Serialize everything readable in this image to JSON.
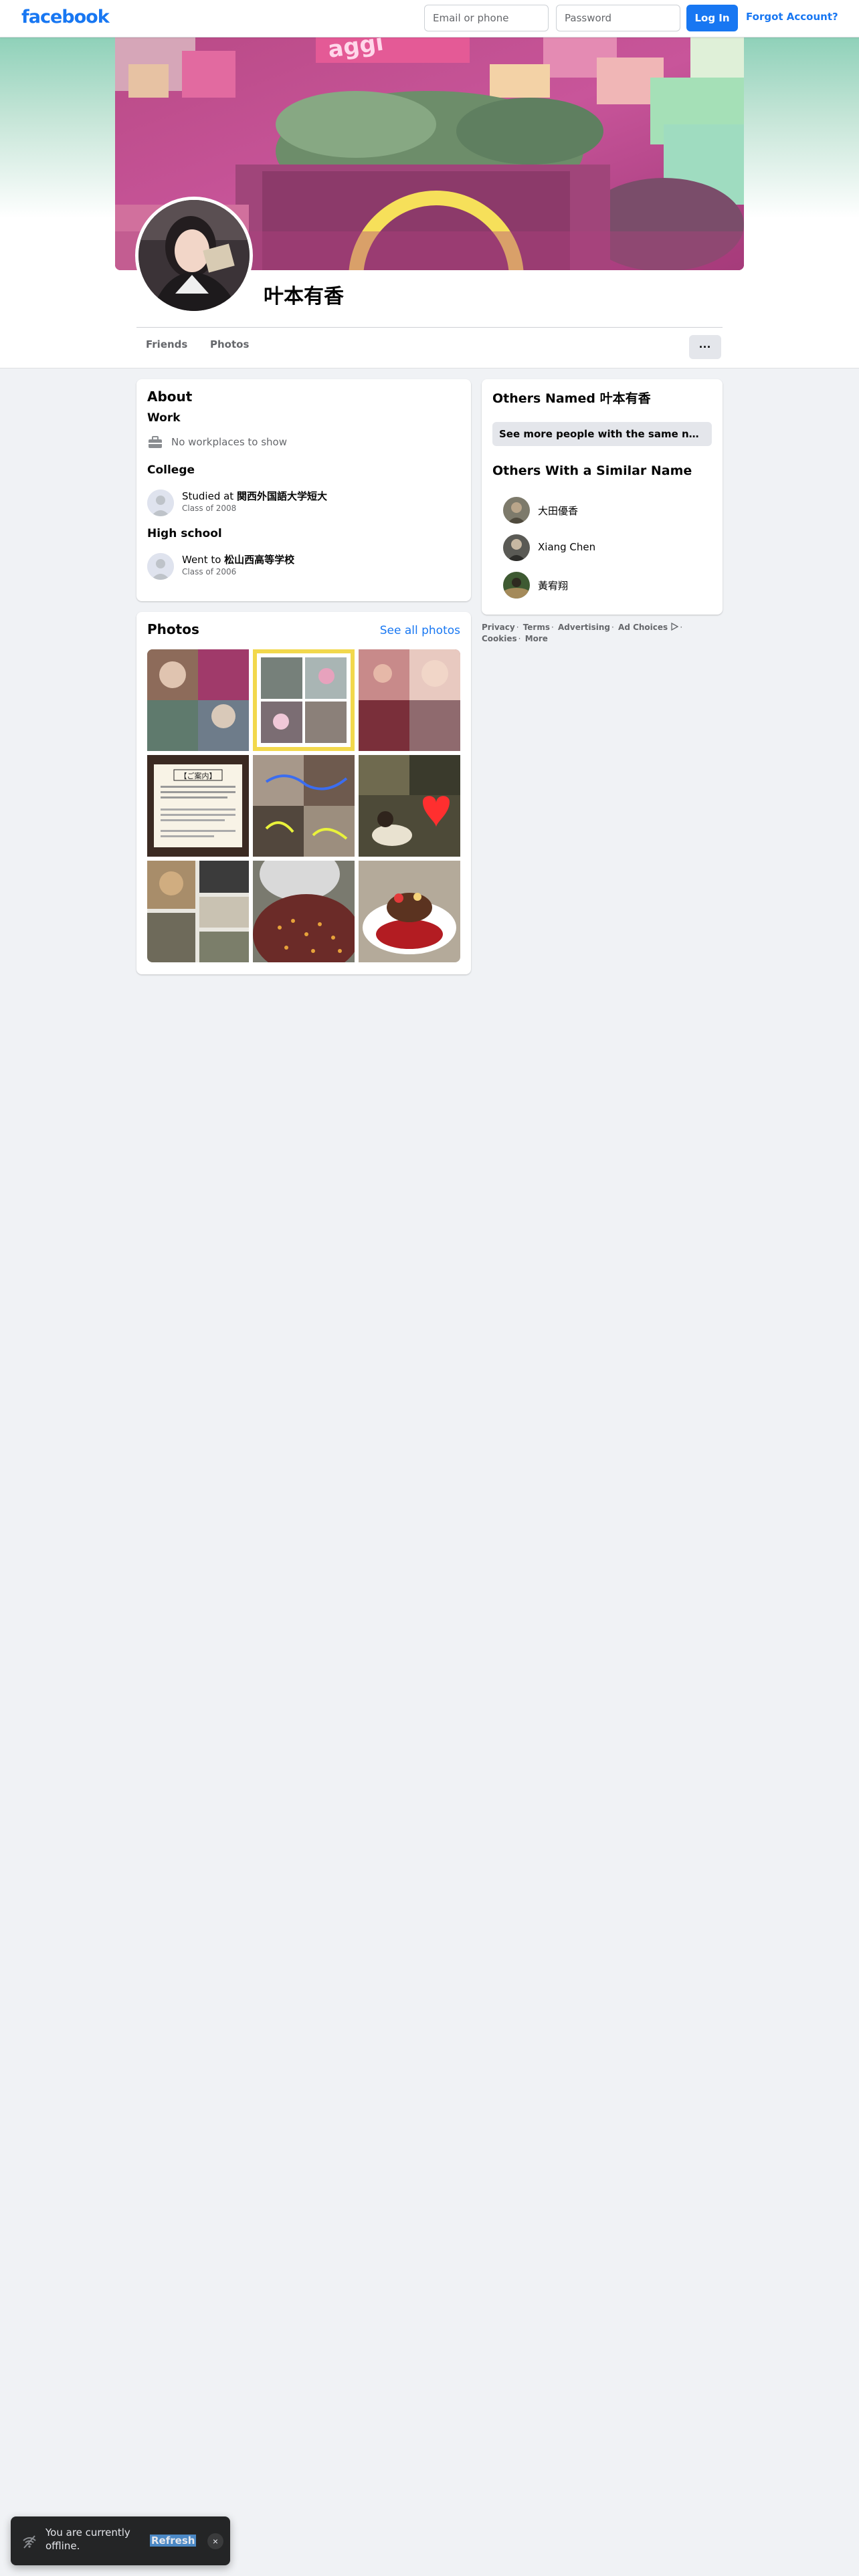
{
  "topbar": {
    "logo": "facebook",
    "email_placeholder": "Email or phone",
    "password_placeholder": "Password",
    "login_label": "Log In",
    "forgot_label": "Forgot Account?"
  },
  "profile": {
    "name": "叶本有香",
    "tabs": [
      {
        "label": "Friends"
      },
      {
        "label": "Photos"
      }
    ],
    "more_label": "···"
  },
  "about": {
    "title": "About",
    "work": {
      "heading": "Work",
      "text": "No workplaces to show",
      "icon": "briefcase-icon"
    },
    "college": {
      "heading": "College",
      "prefix": "Studied at ",
      "school": "関西外国語大学短大",
      "sub": "Class of 2008"
    },
    "high_school": {
      "heading": "High school",
      "prefix": "Went to ",
      "school": "松山西高等学校",
      "sub": "Class of 2006"
    }
  },
  "photos": {
    "title": "Photos",
    "see_all": "See all photos",
    "notice_title": "【ご案内】"
  },
  "others_named": {
    "title": "Others Named 叶本有香",
    "button": "See more people with the same name"
  },
  "similar": {
    "title": "Others With a Similar Name",
    "items": [
      {
        "name": "大田優香"
      },
      {
        "name": "Xiang Chen"
      },
      {
        "name": "黃宥翔"
      }
    ]
  },
  "footer": {
    "links": [
      "Privacy",
      "Terms",
      "Advertising",
      "Ad Choices",
      "Cookies",
      "More"
    ]
  },
  "toast": {
    "message": "You are currently offline.",
    "refresh": "Refresh",
    "close": "×"
  },
  "colors": {
    "brand": "#1877f2",
    "background": "#f0f2f5",
    "toast_bg": "#242526"
  }
}
